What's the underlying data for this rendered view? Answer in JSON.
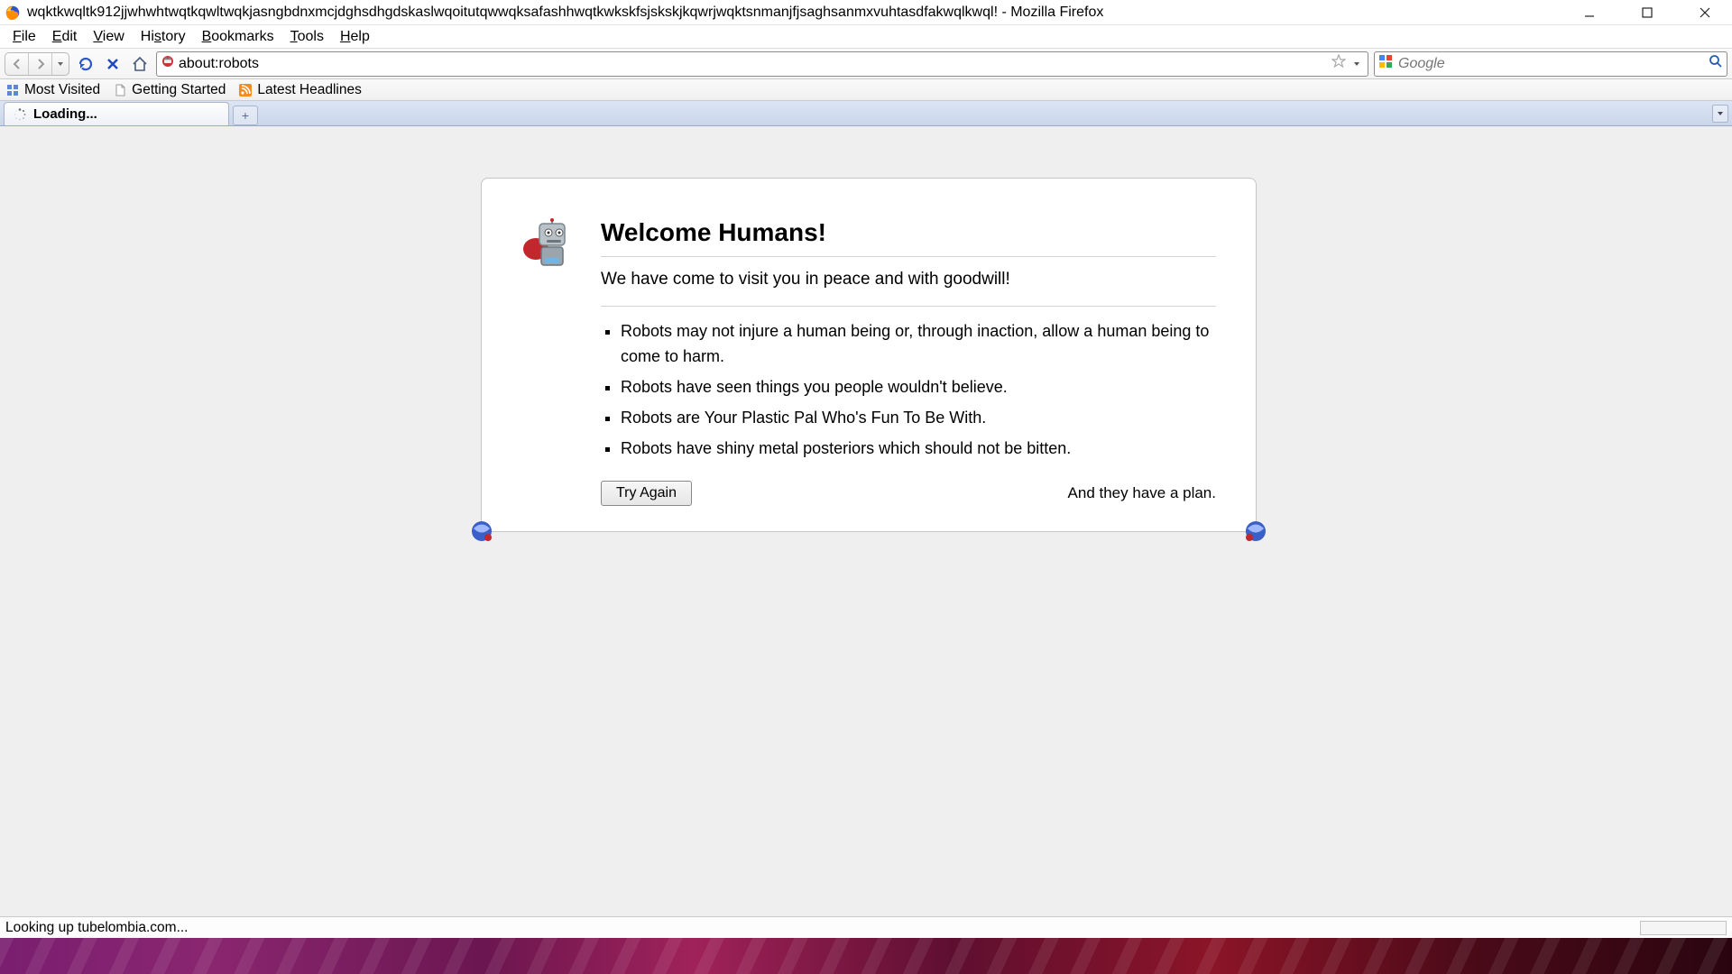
{
  "window": {
    "title": "wqktkwqltk912jjwhwhtwqtkqwltwqkjasngbdnxmcjdghsdhgdskaslwqoitutqwwqksafashhwqtkwkskfsjskskjkqwrjwqktsnmanjfjsaghsanmxvuhtasdfakwqlkwql! - Mozilla Firefox"
  },
  "menu": {
    "items": [
      "File",
      "Edit",
      "View",
      "History",
      "Bookmarks",
      "Tools",
      "Help"
    ]
  },
  "nav": {
    "url": "about:robots",
    "search_placeholder": "Google"
  },
  "bookmarks": {
    "items": [
      "Most Visited",
      "Getting Started",
      "Latest Headlines"
    ]
  },
  "tab": {
    "label": "Loading...",
    "newtab_glyph": "+"
  },
  "page": {
    "heading": "Welcome Humans!",
    "lead": "We have come to visit you in peace and with goodwill!",
    "bullets": [
      "Robots may not injure a human being or, through inaction, allow a human being to come to harm.",
      "Robots have seen things you people wouldn't believe.",
      "Robots are Your Plastic Pal Who's Fun To Be With.",
      "Robots have shiny metal posteriors which should not be bitten."
    ],
    "plan": "And they have a plan.",
    "try_again": "Try Again"
  },
  "status": {
    "text": "Looking up tubelombia.com..."
  }
}
